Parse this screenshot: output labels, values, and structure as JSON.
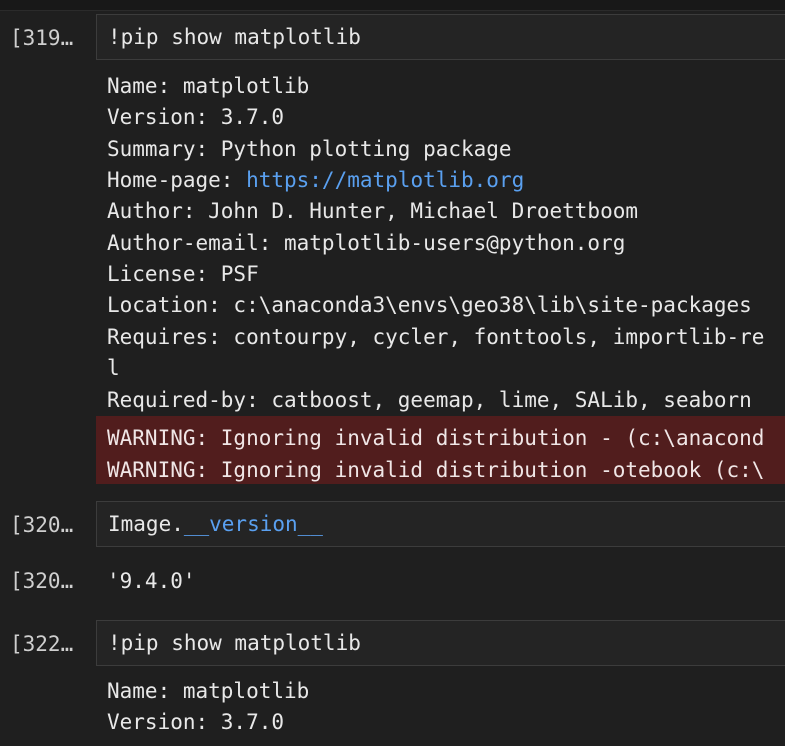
{
  "cells": [
    {
      "prompt": "[319…",
      "code": "!pip show matplotlib",
      "output": {
        "name": "Name: matplotlib",
        "version": "Version: 3.7.0",
        "summary": "Summary: Python plotting package",
        "homepage_label": "Home-page: ",
        "homepage_url": "https://matplotlib.org",
        "author": "Author: John D. Hunter, Michael Droettboom",
        "author_email": "Author-email: matplotlib-users@python.org",
        "license": "License: PSF",
        "location": "Location: c:\\anaconda3\\envs\\geo38\\lib\\site-packages",
        "requires": "Requires: contourpy, cycler, fonttools, importlib-re",
        "requires_wrap": "l",
        "required_by": "Required-by: catboost, geemap, lime, SALib, seaborn",
        "warning_1": "WARNING: Ignoring invalid distribution - (c:\\anacond",
        "warning_2": "WARNING: Ignoring invalid distribution -otebook (c:\\"
      }
    },
    {
      "prompt": "[320…",
      "code_prefix": "Image.",
      "code_attr": "__version__"
    },
    {
      "prompt": "[320…",
      "result": "'9.4.0'"
    },
    {
      "prompt": "[322…",
      "code": "!pip show matplotlib",
      "output": {
        "name": "Name: matplotlib",
        "version": "Version: 3.7.0"
      }
    }
  ],
  "colors": {
    "background": "#1f1f1f",
    "link": "#5aa0f0",
    "warning_bg": "#5a1d1d"
  }
}
